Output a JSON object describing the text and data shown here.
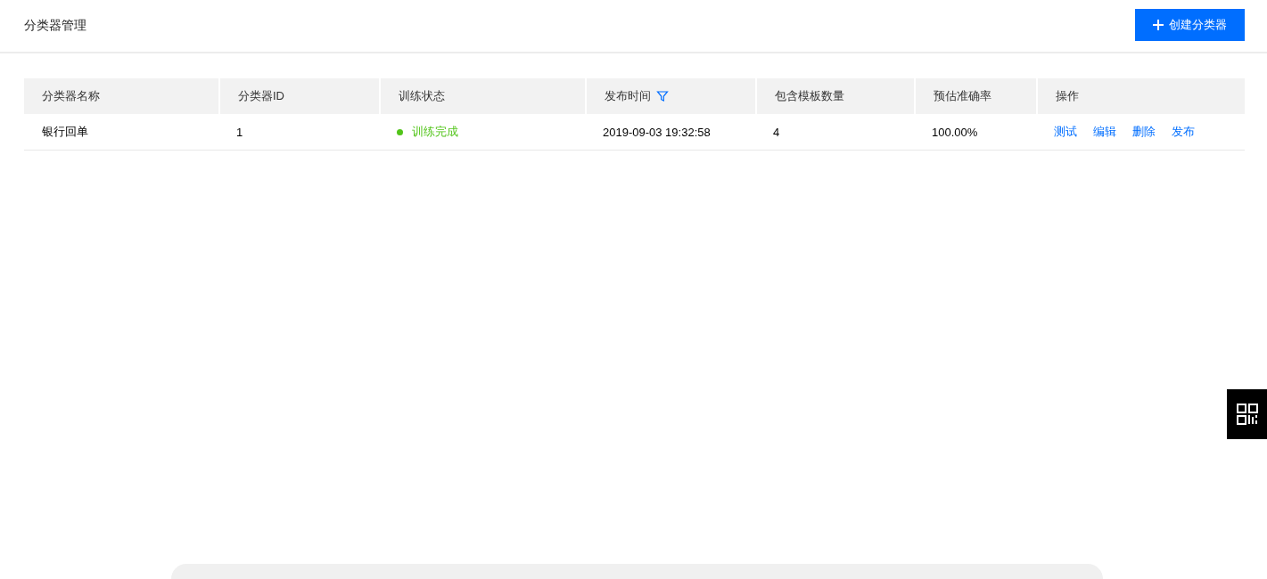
{
  "header": {
    "title": "分类器管理",
    "create_button": "创建分类器"
  },
  "table": {
    "columns": [
      {
        "label": "分类器名称",
        "filterable": false
      },
      {
        "label": "分类器ID",
        "filterable": false
      },
      {
        "label": "训练状态",
        "filterable": false
      },
      {
        "label": "发布时间",
        "filterable": true
      },
      {
        "label": "包含模板数量",
        "filterable": false
      },
      {
        "label": "预估准确率",
        "filterable": false
      },
      {
        "label": "操作",
        "filterable": false
      }
    ],
    "rows": [
      {
        "name": "银行回单",
        "id": "1",
        "status": {
          "label": "训练完成",
          "color": "#52c41a"
        },
        "published": "2019-09-03 19:32:58",
        "templates": "4",
        "accuracy": "100.00%",
        "actions": [
          "测试",
          "编辑",
          "删除",
          "发布"
        ]
      }
    ]
  }
}
